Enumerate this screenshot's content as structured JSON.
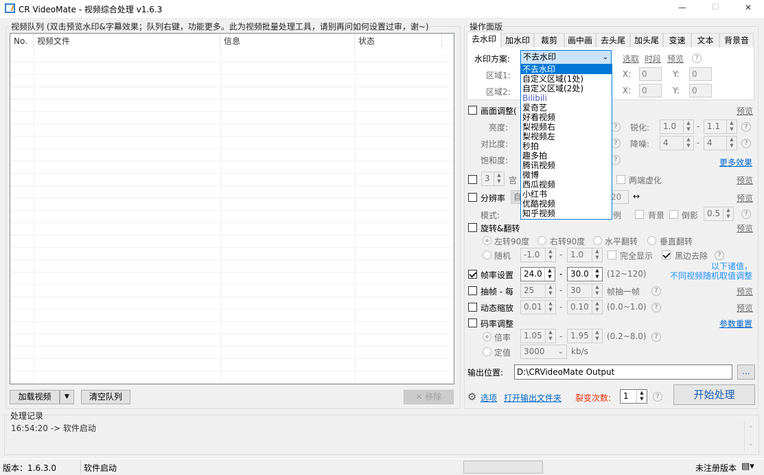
{
  "window": {
    "title": "CR VideoMate - 视频综合处理 v1.6.3",
    "minimize": "—",
    "maximize": "☐",
    "close": "✕"
  },
  "queue": {
    "group_label": "视频队列 (双击预览水印&字幕效果；队列右键，功能更多。此为视频批量处理工具，请别再问如何设置过审，谢~)",
    "columns": [
      "No.",
      "视频文件",
      "信息",
      "状态"
    ],
    "load_button": "加载视频",
    "clear_button": "清空队列",
    "remove_button": "✕ 移除"
  },
  "log": {
    "group_label": "处理记录",
    "entries": [
      "16:54:20 -> 软件启动"
    ]
  },
  "statusbar": {
    "version": "版本：1.6.3.0",
    "status": "软件启动",
    "registration": "未注册版本"
  },
  "panel": {
    "group_label": "操作面版",
    "tabs": [
      "去水印",
      "加水印",
      "裁剪",
      "画中画",
      "去头尾",
      "加头尾",
      "变速",
      "文本",
      "背景音"
    ],
    "watermark": {
      "label": "水印方案:",
      "selected": "不去水印",
      "pick": "选取",
      "period": "时段",
      "preview": "预览",
      "region1": "区域1:",
      "region2": "区域2:",
      "x_label": "X:",
      "y_label": "Y:",
      "x1": "0",
      "y1": "0",
      "x2": "0",
      "y2": "0",
      "options": [
        "不去水印",
        "自定义区域(1处)",
        "自定义区域(2处)",
        "Bilibili",
        "爱奇艺",
        "好看视频",
        "梨视频右",
        "梨视频左",
        "秒拍",
        "趣多拍",
        "腾讯视频",
        "微博",
        "西瓜视频",
        "小红书",
        "优酷视频",
        "知乎视频"
      ]
    },
    "picture": {
      "label": "画面调整(",
      "preview": "预览",
      "brightness": "亮度:",
      "contrast": "对比度:",
      "saturation": "饱和度:",
      "sharpen": "锐化:",
      "sharpen_min": "1.0",
      "sharpen_max": "1.1",
      "denoise": "降噪:",
      "denoise_min": "4",
      "denoise_max": "4",
      "more": "更多效果"
    },
    "grid": {
      "value": "3",
      "label": "宫",
      "blur_ends": "两端虚化",
      "preview": "预览"
    },
    "resolution": {
      "label": "分辨率",
      "combo_partial": "自",
      "value_partial": "20",
      "swap": "↔",
      "preview": "预览",
      "mode": "模式:",
      "ratio_partial": "例",
      "background": "背景",
      "reflection": "倒影",
      "reflection_value": "0.5"
    },
    "rotate": {
      "label": "旋转&翻转",
      "preview": "预览",
      "left90": "左转90度",
      "right90": "右转90度",
      "hflip": "水平翻转",
      "vflip": "垂直翻转",
      "random": "随机",
      "min": "-1.0",
      "max": "1.0",
      "full_display": "完全显示",
      "remove_black": "黑边去除"
    },
    "note": {
      "line1": "以下诸值，",
      "line2": "不同视频随机取值调整"
    },
    "framerate": {
      "label": "帧率设置",
      "checked": true,
      "min": "24.0",
      "max": "30.0",
      "range": "(12~120)"
    },
    "drop_frame": {
      "label": "抽帧 - 每",
      "min": "25",
      "max": "30",
      "suffix": "帧抽一帧",
      "preview": "预览"
    },
    "zoom": {
      "label": "动态缩放",
      "min": "0.01",
      "max": "0.10",
      "range": "(0.0~1.0)",
      "preview": "预览"
    },
    "bitrate": {
      "label": "码率调整",
      "reset": "参数重置",
      "ratio": "倍率",
      "min": "1.05",
      "max": "1.95",
      "range": "(0.2~8.0)",
      "fixed": "定值",
      "fixed_value": "3000",
      "unit": "kb/s"
    },
    "output": {
      "label": "输出位置:",
      "path": "D:\\CRVideoMate Output",
      "browse": "..."
    },
    "footer": {
      "options": "选项",
      "open_folder": "打开输出文件夹",
      "fission_label": "裂变次数:",
      "fission_value": "1",
      "start": "开始处理"
    },
    "dash": "-",
    "help": "?"
  }
}
